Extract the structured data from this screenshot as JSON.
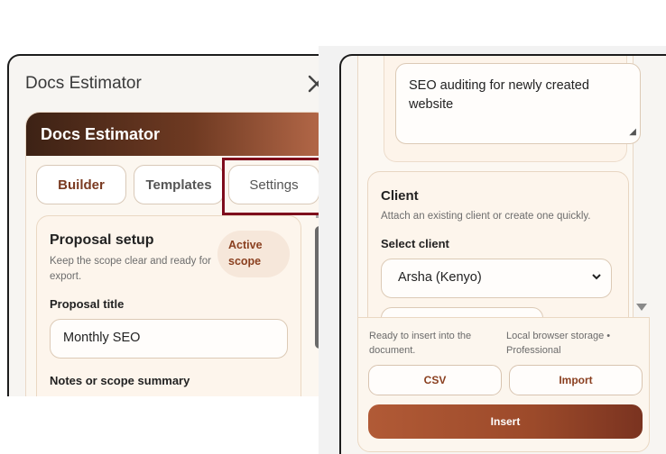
{
  "left_panel": {
    "window_title": "Docs Estimator",
    "banner_title": "Docs Estimator",
    "tabs": [
      {
        "label": "Builder"
      },
      {
        "label": "Templates"
      },
      {
        "label": "Settings"
      }
    ],
    "proposal": {
      "title": "Proposal setup",
      "description": "Keep the scope clear and ready for export.",
      "badge": "Active scope",
      "title_label": "Proposal title",
      "title_value": "Monthly SEO",
      "notes_label": "Notes or scope summary"
    }
  },
  "right_panel": {
    "notes_value": "SEO auditing for newly created website",
    "client": {
      "title": "Client",
      "description": "Attach an existing client or create one quickly.",
      "select_label": "Select client",
      "selected": "Arsha (Kenyo)"
    },
    "footer": {
      "status_left": "Ready to insert into the document.",
      "status_right": "Local browser storage • Professional",
      "csv_label": "CSV",
      "import_label": "Import",
      "insert_label": "Insert"
    }
  },
  "colors": {
    "accent": "#8a3f1f",
    "highlight_box": "#7e0b1c",
    "insert_button": "#9c4a2a"
  },
  "icons": [
    "close-icon",
    "chevron-down-icon",
    "resize-grip-icon",
    "scroll-down-icon"
  ]
}
